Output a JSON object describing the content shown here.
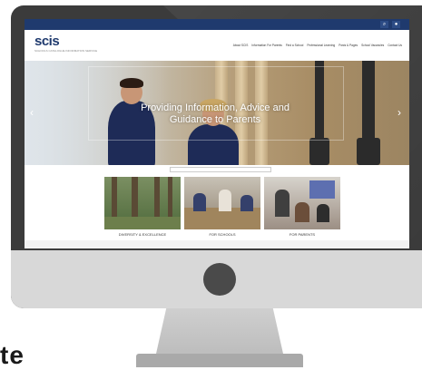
{
  "site": {
    "logo": "scis",
    "logo_sub": "SCHOOLS CATALOGUE INFORMATION SERVICE"
  },
  "top_bar": {
    "icons": [
      "search-icon",
      "user-icon"
    ]
  },
  "nav": {
    "items": [
      "About SCIS",
      "Information For Parents",
      "Find a School",
      "Professional Learning",
      "Posts & Pages",
      "School Vacancies",
      "Contact Us"
    ]
  },
  "hero": {
    "caption_line1": "Providing Information, Advice and",
    "caption_line2": "Guidance to Parents",
    "left_arrow": "‹",
    "right_arrow": "›"
  },
  "cards": [
    {
      "label": "DIVERSITY & EXCELLENCE"
    },
    {
      "label": "FOR SCHOOLS"
    },
    {
      "label": "FOR PARENTS"
    }
  ],
  "outside": {
    "text": "te"
  },
  "colors": {
    "brand_navy": "#1f3a6e",
    "monitor_bezel": "#3b3b3b",
    "monitor_chin": "#d8d8d8"
  }
}
